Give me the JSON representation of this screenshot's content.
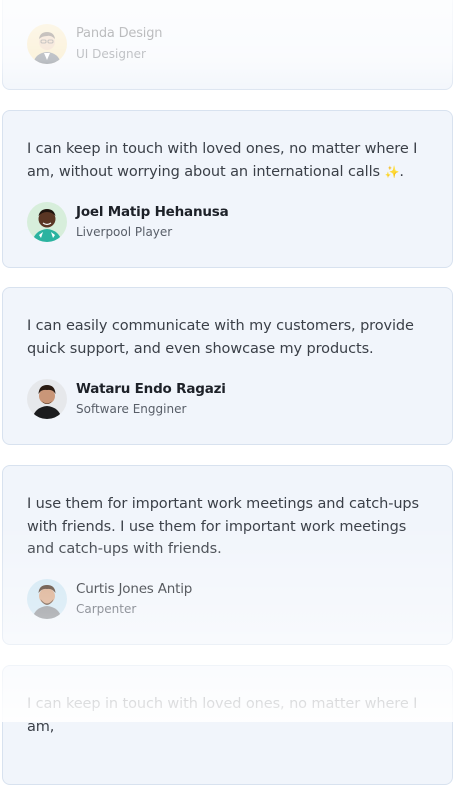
{
  "testimonials": [
    {
      "quote": "",
      "name": "Panda Design",
      "role": "UI Designer",
      "avatar_icon": "avatar-panda-design"
    },
    {
      "quote": "I can keep in touch with loved ones, no matter where I am, without worrying about an international calls",
      "quote_suffix": ".",
      "emoji": "✨",
      "name": "Joel Matip Hehanusa",
      "role": "Liverpool Player",
      "avatar_icon": "avatar-joel-matip"
    },
    {
      "quote": " I can easily communicate with my customers, provide quick support, and even showcase my products.",
      "name": "Wataru Endo Ragazi",
      "role": "Software Engginer",
      "avatar_icon": "avatar-wataru-endo"
    },
    {
      "quote": " I use them for important work meetings and catch-ups with friends. I use them for important work meetings and catch-ups with friends.",
      "name": "Curtis Jones Antip",
      "role": "Carpenter",
      "avatar_icon": "avatar-curtis-jones"
    },
    {
      "quote": "I can keep in touch with loved ones, no matter where I am,",
      "name": "",
      "role": ""
    }
  ],
  "colors": {
    "card_background": "#f1f5fb",
    "card_border": "#d8e2ef",
    "quote_text": "#3b4048",
    "name_text": "#1d2128",
    "role_text": "#585e68"
  }
}
